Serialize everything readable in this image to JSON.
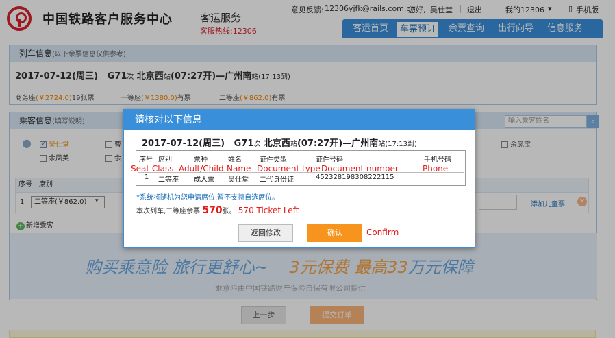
{
  "header": {
    "logo_title": "中国铁路客户服务中心",
    "logo_sub": "客运服务",
    "hotline": "客服热线:12306",
    "feedback_label": "意见反馈:",
    "feedback_email": "12306yjfk@rails.com.cn",
    "greeting": "您好,",
    "user_name": "吴仕堂",
    "sep": "|",
    "logout": "退出",
    "my12306": "我的12306",
    "mobile": "手机版"
  },
  "nav": {
    "items": [
      {
        "label": "客运首页"
      },
      {
        "label": "车票预订"
      },
      {
        "label": "余票查询"
      },
      {
        "label": "出行向导"
      },
      {
        "label": "信息服务"
      }
    ]
  },
  "train_panel": {
    "title": "列车信息",
    "title_note": "(以下余票信息仅供参考)",
    "date": "2017-07-12(周三)",
    "train_no": "G71",
    "train_suffix": "次",
    "from": "北京西",
    "from_suffix": "站",
    "depart": "(07:27开)",
    "dash": "—",
    "to": "广州南",
    "to_suffix": "站",
    "arrive": "(17:13到)",
    "seats": [
      {
        "name": "商务座",
        "price": "(￥2724.0)",
        "avail": "19张票"
      },
      {
        "name": "一等座",
        "price": "(￥1380.0)",
        "avail": "有票"
      },
      {
        "name": "二等座",
        "price": "(￥862.0)",
        "avail": "有票"
      }
    ]
  },
  "passenger_panel": {
    "title": "乘客信息",
    "title_note": "(填写说明)",
    "search_placeholder": "输入乘客姓名",
    "passengers": [
      "吴仕堂",
      "曹",
      "余凤宝",
      "余凤美",
      "余"
    ],
    "col_no": "序号",
    "col_seat": "席别",
    "row_no": "1",
    "row_seat": "二等座(￥862.0)",
    "add_child": "添加儿童票",
    "add_passenger": "新增乘客"
  },
  "insurance": {
    "main_a": "购买乘意险  旅行更舒心~",
    "main_b": "3元保费  最高",
    "main_c": "33",
    "main_d": "万元保障",
    "sub": "乘意险由中国铁路财产保险自保有限公司提供"
  },
  "bottom_buttons": {
    "prev": "上一步",
    "submit": "提交订单"
  },
  "modal": {
    "title": "请核对以下信息",
    "date": "2017-07-12(周三)",
    "train_no": "G71",
    "train_suffix": "次",
    "from": "北京西",
    "from_suffix": "站",
    "depart": "(07:27开)",
    "dash": "—",
    "to": "广州南",
    "to_suffix": "站",
    "arrive": "(17:13到)",
    "headers": [
      "序号",
      "席别",
      "票种",
      "姓名",
      "证件类型",
      "证件号码",
      "手机号码"
    ],
    "annotations": [
      "Seat Class",
      "Adult/Child",
      "Name",
      "Document type",
      "Document number",
      "Phone"
    ],
    "row": [
      "1",
      "二等座",
      "成人票",
      "吴仕堂",
      "二代身份证",
      "452328198308222115",
      ""
    ],
    "note": "*系统将随机为您申请席位,暂不支持自选席位。",
    "remain_prefix": "本次列车,二等座余票",
    "remain_count": "570",
    "remain_suffix": "张。",
    "remain_annot": "570  Ticket Left",
    "back_button": "返回修改",
    "ok_button": "确认",
    "confirm_annot": "Confirm"
  },
  "colors": {
    "accent": "#3a8fdb",
    "brand_red": "#d7232c",
    "annotation_red": "#e41b1b",
    "orange": "#f7941d"
  }
}
